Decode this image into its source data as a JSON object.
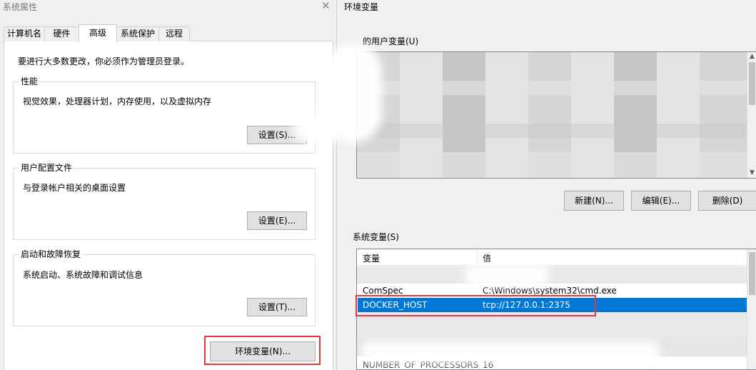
{
  "system_properties": {
    "window_title": "系统属性",
    "close_glyph": "✕",
    "tabs": [
      {
        "label": "计算机名"
      },
      {
        "label": "硬件"
      },
      {
        "label": "高级"
      },
      {
        "label": "系统保护"
      },
      {
        "label": "远程"
      }
    ],
    "notice": "要进行大多数更改，你必须作为管理员登录。",
    "performance": {
      "title": "性能",
      "desc": "视觉效果，处理器计划，内存使用，以及虚拟内存",
      "button": "设置(S)..."
    },
    "user_profiles": {
      "title": "用户配置文件",
      "desc": "与登录帐户相关的桌面设置",
      "button": "设置(E)..."
    },
    "startup_recovery": {
      "title": "启动和故障恢复",
      "desc": "系统启动、系统故障和调试信息",
      "button": "设置(T)..."
    },
    "env_button": "环境变量(N)..."
  },
  "environment_variables": {
    "window_title": "环境变量",
    "user_section": {
      "label": "的用户变量(U)",
      "buttons": {
        "new": "新建(N)...",
        "edit": "编辑(E)...",
        "delete": "删除(D)"
      }
    },
    "system_section": {
      "label": "系统变量(S)",
      "columns": {
        "name": "变量",
        "value": "值"
      },
      "rows": [
        {
          "name": "ComSpec",
          "value": "C:\\Windows\\system32\\cmd.exe",
          "selected": false
        },
        {
          "name": "DOCKER_HOST",
          "value": "tcp://127.0.0.1:2375",
          "selected": true
        },
        {
          "name": "NUMBER_OF_PROCESSORS",
          "value": "16",
          "selected": false
        }
      ]
    }
  },
  "colors": {
    "selection": "#0078d7",
    "highlight_box": "#e03a3a",
    "dialog_bg": "#f0f0f0"
  }
}
